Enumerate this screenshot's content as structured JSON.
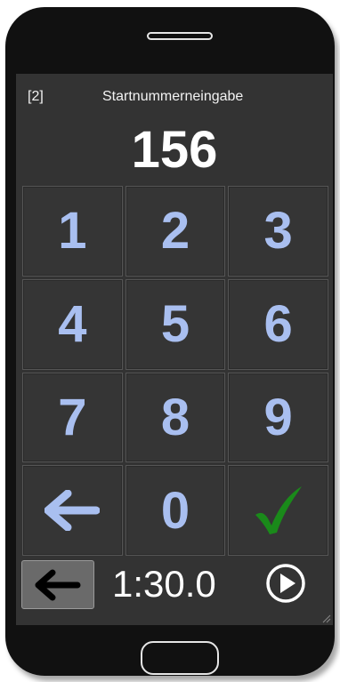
{
  "colors": {
    "screen_bg": "#333333",
    "key_digit": "#a9bff0",
    "confirm": "#1a8a1a",
    "text": "#ffffff"
  },
  "header": {
    "screen_id": "[2]",
    "title": "Startnummerneingabe"
  },
  "display": {
    "value": "156"
  },
  "keypad": {
    "keys": [
      {
        "label": "1"
      },
      {
        "label": "2"
      },
      {
        "label": "3"
      },
      {
        "label": "4"
      },
      {
        "label": "5"
      },
      {
        "label": "6"
      },
      {
        "label": "7"
      },
      {
        "label": "8"
      },
      {
        "label": "9"
      },
      {
        "icon": "arrow-left-icon"
      },
      {
        "label": "0"
      },
      {
        "icon": "checkmark-icon"
      }
    ]
  },
  "footer": {
    "back_icon": "arrow-left-icon",
    "timer": "1:30.0",
    "play_icon": "play-circle-icon"
  }
}
